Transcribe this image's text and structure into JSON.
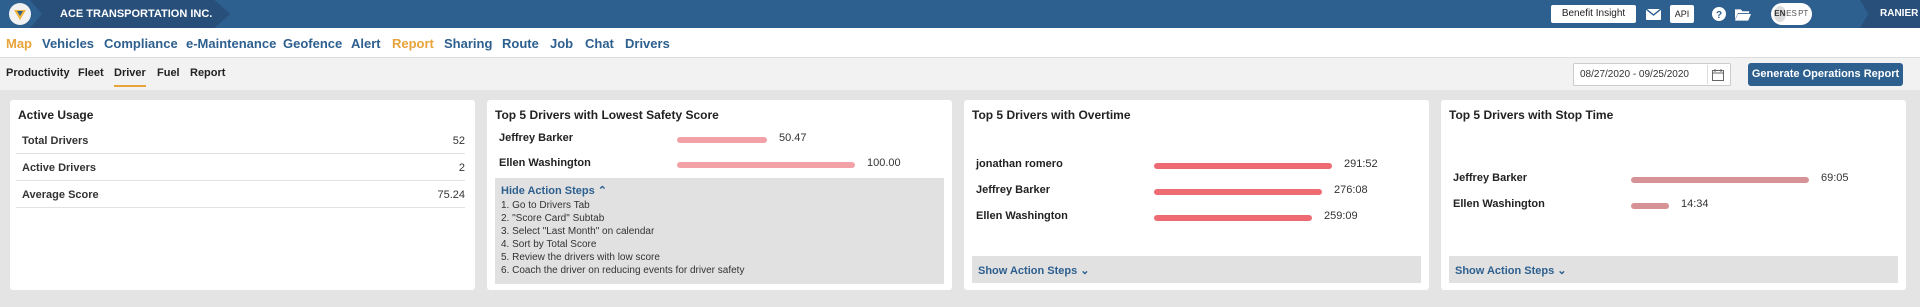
{
  "topbar": {
    "company": "ACE TRANSPORTATION INC.",
    "benefit_insight": "Benefit Insight",
    "api": "API",
    "languages": [
      "EN",
      "ES",
      "PT"
    ],
    "active_language": "EN",
    "user": "RANIER",
    "icons": [
      "logo-icon",
      "mail-icon",
      "help-icon",
      "folder-icon"
    ]
  },
  "mainnav": {
    "items": [
      "Map",
      "Vehicles",
      "Compliance",
      "e-Maintenance",
      "Geofence",
      "Alert",
      "Report",
      "Sharing",
      "Route",
      "Job",
      "Chat",
      "Drivers"
    ],
    "highlighted": [
      "Map",
      "Report"
    ]
  },
  "subnav": {
    "items": [
      "Productivity",
      "Fleet",
      "Driver",
      "Fuel",
      "Report"
    ],
    "active": "Driver",
    "date_range": "08/27/2020 - 09/25/2020",
    "generate_button": "Generate Operations Report"
  },
  "active_usage": {
    "title": "Active Usage",
    "rows": [
      {
        "label": "Total Drivers",
        "value": "52"
      },
      {
        "label": "Active Drivers",
        "value": "2"
      },
      {
        "label": "Average Score",
        "value": "75.24"
      }
    ]
  },
  "safety": {
    "title": "Top 5 Drivers with Lowest Safety Score",
    "bar_color": "#f2a2a6",
    "scale_max": 100,
    "rows": [
      {
        "name": "Jeffrey Barker",
        "value": "50.47",
        "num": 50.47
      },
      {
        "name": "Ellen Washington",
        "value": "100.00",
        "num": 100
      }
    ],
    "toggle": "Hide Action Steps",
    "steps": [
      "1. Go to Drivers Tab",
      "2. \"Score Card\" Subtab",
      "3. Select \"Last Month\" on calendar",
      "4. Sort by Total Score",
      "5. Review the drivers with low score",
      "6. Coach the driver on reducing events for driver safety"
    ]
  },
  "overtime": {
    "title": "Top 5 Drivers with Overtime",
    "bar_color": "#ef6b73",
    "scale_max": 291.87,
    "rows": [
      {
        "name": "jonathan romero",
        "value": "291:52",
        "num": 291.87
      },
      {
        "name": "Jeffrey Barker",
        "value": "276:08",
        "num": 276.13
      },
      {
        "name": "Ellen Washington",
        "value": "259:09",
        "num": 259.15
      }
    ],
    "toggle": "Show Action Steps"
  },
  "stoptime": {
    "title": "Top 5 Drivers with Stop Time",
    "bar_color": "#d69294",
    "scale_max": 69.08,
    "rows": [
      {
        "name": "Jeffrey Barker",
        "value": "69:05",
        "num": 69.08
      },
      {
        "name": "Ellen Washington",
        "value": "14:34",
        "num": 14.57
      }
    ],
    "toggle": "Show Action Steps"
  }
}
